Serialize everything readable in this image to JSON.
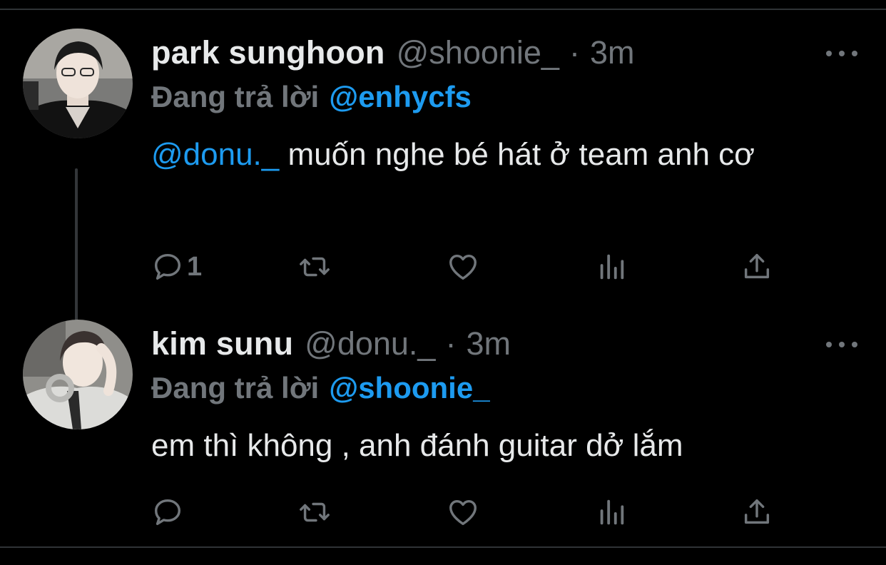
{
  "tweets": [
    {
      "display_name": "park sunghoon",
      "handle": "@shoonie_",
      "separator": "·",
      "time": "3m",
      "replying_label": "Đang trả lời",
      "replying_to": "@enhycfs",
      "body_mention": "@donu._",
      "body_text": " muốn nghe bé hát ở team anh cơ",
      "reply_count": "1"
    },
    {
      "display_name": "kim sunu",
      "handle": "@donu._",
      "separator": "·",
      "time": "3m",
      "replying_label": "Đang trả lời",
      "replying_to": "@shoonie_",
      "body_text": "em thì không , anh đánh guitar dở lắm",
      "reply_count": ""
    }
  ],
  "colors": {
    "background": "#000000",
    "text": "#e7e9ea",
    "muted": "#71767b",
    "link": "#1d9bf0",
    "divider": "#2f3336"
  },
  "icons": [
    "reply-icon",
    "retweet-icon",
    "like-icon",
    "views-icon",
    "share-icon",
    "more-icon"
  ]
}
